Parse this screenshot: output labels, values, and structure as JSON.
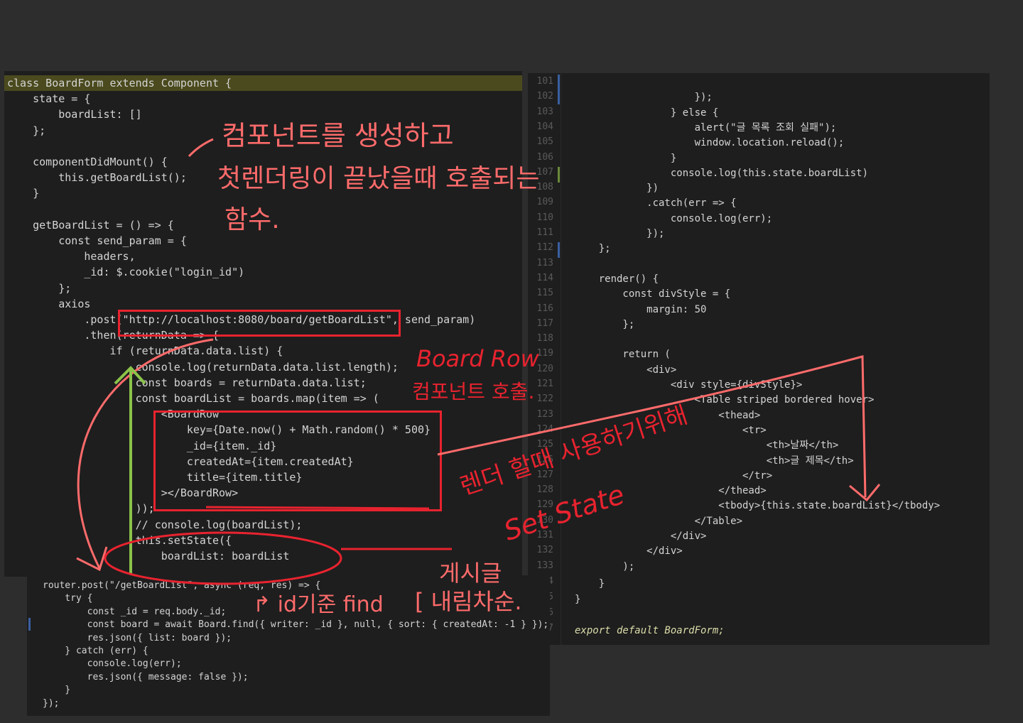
{
  "left_panel": {
    "lines": [
      "class BoardForm extends Component {",
      "    state = {",
      "        boardList: []",
      "    };",
      "",
      "    componentDidMount() {",
      "        this.getBoardList();",
      "    }",
      "",
      "    getBoardList = () => {",
      "        const send_param = {",
      "            headers,",
      "            _id: $.cookie(\"login_id\")",
      "        };",
      "        axios",
      "            .post(\"http://localhost:8080/board/getBoardList\", send_param)",
      "            .then(returnData => {",
      "                if (returnData.data.list) {",
      "                    console.log(returnData.data.list.length);",
      "                    const boards = returnData.data.list;",
      "                    const boardList = boards.map(item => (",
      "                        <BoardRow",
      "                            key={Date.now() + Math.random() * 500}",
      "                            _id={item._id}",
      "                            createdAt={item.createdAt}",
      "                            title={item.title}",
      "                        ></BoardRow>",
      "                    ));",
      "                    // console.log(boardList);",
      "                    this.setState({",
      "                        boardList: boardList"
    ]
  },
  "right_panel": {
    "line_numbers": [
      "101",
      "102",
      "103",
      "104",
      "105",
      "106",
      "107",
      "108",
      "109",
      "110",
      "111",
      "112",
      "113",
      "114",
      "115",
      "116",
      "117",
      "118",
      "119",
      "120",
      "121",
      "122",
      "123",
      "124",
      "125",
      "126",
      "127",
      "128",
      "129",
      "130",
      "131",
      "132",
      "133"
    ],
    "lines": [
      "",
      "                    });",
      "                } else {",
      "                    alert(\"글 목록 조회 실패\");",
      "                    window.location.reload();",
      "                }",
      "                console.log(this.state.boardList)",
      "            })",
      "            .catch(err => {",
      "                console.log(err);",
      "            });",
      "    };",
      "",
      "    render() {",
      "        const divStyle = {",
      "            margin: 50",
      "        };",
      "",
      "        return (",
      "            <div>",
      "                <div style={divStyle}>",
      "                    <Table striped bordered hover>",
      "                        <thead>",
      "                            <tr>",
      "                                <th>날짜</th>",
      "                                <th>글 제목</th>",
      "                            </tr>",
      "                        </thead>",
      "                        <tbody>{this.state.boardList}</tbody>",
      "                    </Table>",
      "                </div>",
      "            </div>",
      "        );"
    ],
    "tail_lines": [
      "    }",
      "}",
      "",
      "export default BoardForm;"
    ],
    "tail_numbers": [
      "4",
      "5",
      "6",
      "7"
    ]
  },
  "router_panel": {
    "lines": [
      "router.post(\"/getBoardList\", async (req, res) => {",
      "    try {",
      "        const _id = req.body._id;",
      "        const board = await Board.find({ writer: _id }, null, { sort: { createdAt: -1 } });",
      "        res.json({ list: board });",
      "    } catch (err) {",
      "        console.log(err);",
      "        res.json({ message: false });",
      "    }",
      "});"
    ]
  },
  "annotations": {
    "component_mount_1": "컴포넌트를 생성하고",
    "component_mount_2": "첫렌더링이 끝났을때 호출되는",
    "component_mount_3": "함수.",
    "board_row_1": "Board Row",
    "board_row_2": "컴포넌트 호출.",
    "render_use_1": "렌더 할때 사용하기위해",
    "render_use_2": "Set State",
    "post_sort_1": "게시글",
    "post_sort_2": "[ 내림차순.",
    "find_note": "↱ id기준 find"
  },
  "colors": {
    "annotation": "#ff6b6b",
    "box": "#e8232f",
    "arrow_green": "#8bc34a"
  }
}
